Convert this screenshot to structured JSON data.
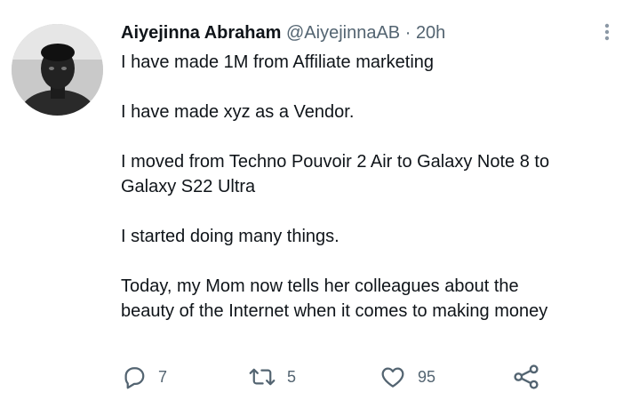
{
  "tweet": {
    "author_name": "Aiyejinna Abraham",
    "handle": "@AiyejinnaAB",
    "separator": "·",
    "time": "20h",
    "lines": [
      "I have made 1M from Affiliate marketing",
      "",
      "I have made xyz as a Vendor.",
      "",
      "I moved from Techno Pouvoir 2 Air to Galaxy Note 8 to",
      "Galaxy S22 Ultra",
      "",
      "I started doing many things.",
      "",
      "Today, my Mom now tells her colleagues about the",
      "beauty of the Internet when it comes to making money"
    ]
  },
  "actions": {
    "reply_count": "7",
    "retweet_count": "5",
    "like_count": "95"
  },
  "icons": {
    "reply": "reply-icon",
    "retweet": "retweet-icon",
    "like": "heart-icon",
    "share": "share-icon",
    "more": "more-icon"
  },
  "colors": {
    "text": "#0f1419",
    "secondary": "#536471"
  }
}
